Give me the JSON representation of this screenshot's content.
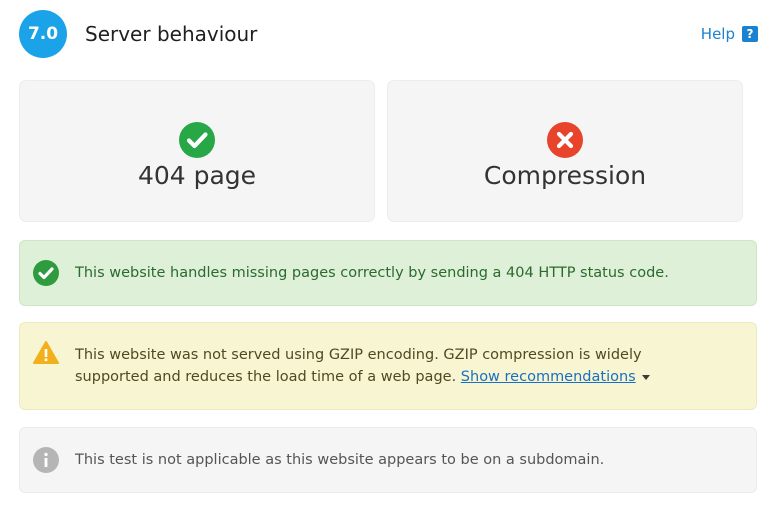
{
  "section": {
    "number": "7.0",
    "title": "Server behaviour",
    "help_label": "Help",
    "help_icon": "question-mark-icon",
    "badge_color": "#1aa3e8",
    "link_color": "#1a82d0"
  },
  "tiles": [
    {
      "label": "404 page",
      "status": "pass",
      "icon": "check-circle-icon",
      "icon_color": "#27a745"
    },
    {
      "label": "Compression",
      "status": "fail",
      "icon": "x-circle-icon",
      "icon_color": "#e8432b"
    }
  ],
  "messages": {
    "success": {
      "icon": "check-circle-icon",
      "text": "This website handles missing pages correctly by sending a 404 HTTP status code.",
      "color": "#dff0d8"
    },
    "warning": {
      "icon": "warning-triangle-icon",
      "line1": "This website was not served using GZIP encoding. GZIP compression is widely",
      "line2": "supported and reduces the load time of a web page.",
      "link_label": "Show recommendations",
      "color": "#f7f5d2"
    },
    "info": {
      "icon": "info-circle-icon",
      "text": "This test is not applicable as this website appears to be on a subdomain.",
      "color": "#f5f5f5"
    }
  }
}
